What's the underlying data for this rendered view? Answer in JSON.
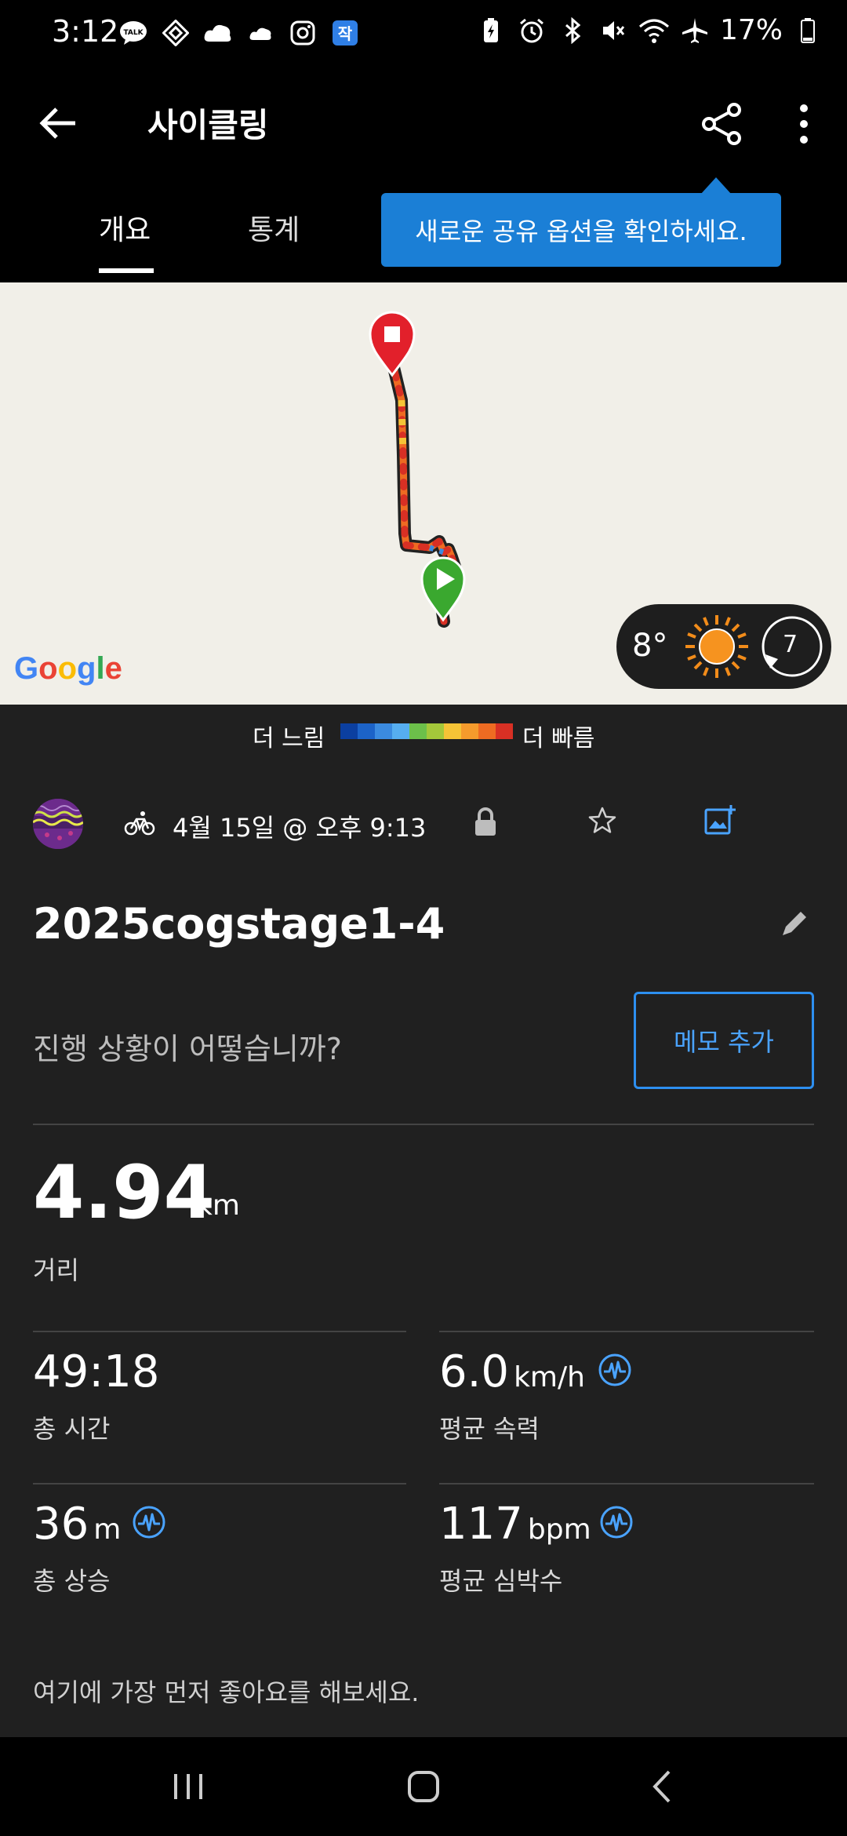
{
  "status_bar": {
    "time": "3:12",
    "battery": "17%",
    "left_icons": [
      "talk-icon",
      "sync-icon",
      "cloud-icon",
      "cloud-small-icon",
      "instagram-icon",
      "app-icon"
    ],
    "right_icons": [
      "battery-saver-icon",
      "alarm-icon",
      "bluetooth-icon",
      "mute-icon",
      "wifi-icon",
      "airplane-icon",
      "battery-icon"
    ]
  },
  "app_bar": {
    "title": "사이클링"
  },
  "tabs": [
    {
      "label": "개요",
      "active": true
    },
    {
      "label": "통계",
      "active": false
    }
  ],
  "tooltip": {
    "text": "새로운 공유 옵션을 확인하세요."
  },
  "map": {
    "attribution": "Google",
    "weather": {
      "temperature": "8°",
      "condition": "sun-icon",
      "wind": "7"
    }
  },
  "legend": {
    "slow": "더 느림",
    "fast": "더 빠름",
    "colors": [
      "#0b3fa0",
      "#1c63c8",
      "#3b8be0",
      "#56aef0",
      "#6cc04a",
      "#a4c83a",
      "#f5c436",
      "#f59b2c",
      "#ee6b22",
      "#d83024"
    ]
  },
  "activity": {
    "date": "4월 15일 @ 오후 9:13",
    "name": "2025cogstage1-4",
    "notes_prompt": "진행 상황이 어떻습니까?",
    "memo_button": "메모 추가"
  },
  "distance": {
    "value": "4.94",
    "unit": "km",
    "label": "거리"
  },
  "stats": [
    {
      "value": "49:18",
      "unit": "",
      "label": "총 시간",
      "icon": false
    },
    {
      "value": "6.0",
      "unit": "km/h",
      "label": "평균 속력",
      "icon": true
    },
    {
      "value": "36",
      "unit": "m",
      "label": "총 상승",
      "icon": true
    },
    {
      "value": "117",
      "unit": "bpm",
      "label": "평균 심박수",
      "icon": true
    }
  ],
  "like_prompt": "여기에 가장 먼저 좋아요를 해보세요.",
  "colors": {
    "accent": "#1b7fd6",
    "link": "#4aa3ff",
    "background": "#202020",
    "route_start": "#3aa82f",
    "route_end": "#e2202b"
  }
}
